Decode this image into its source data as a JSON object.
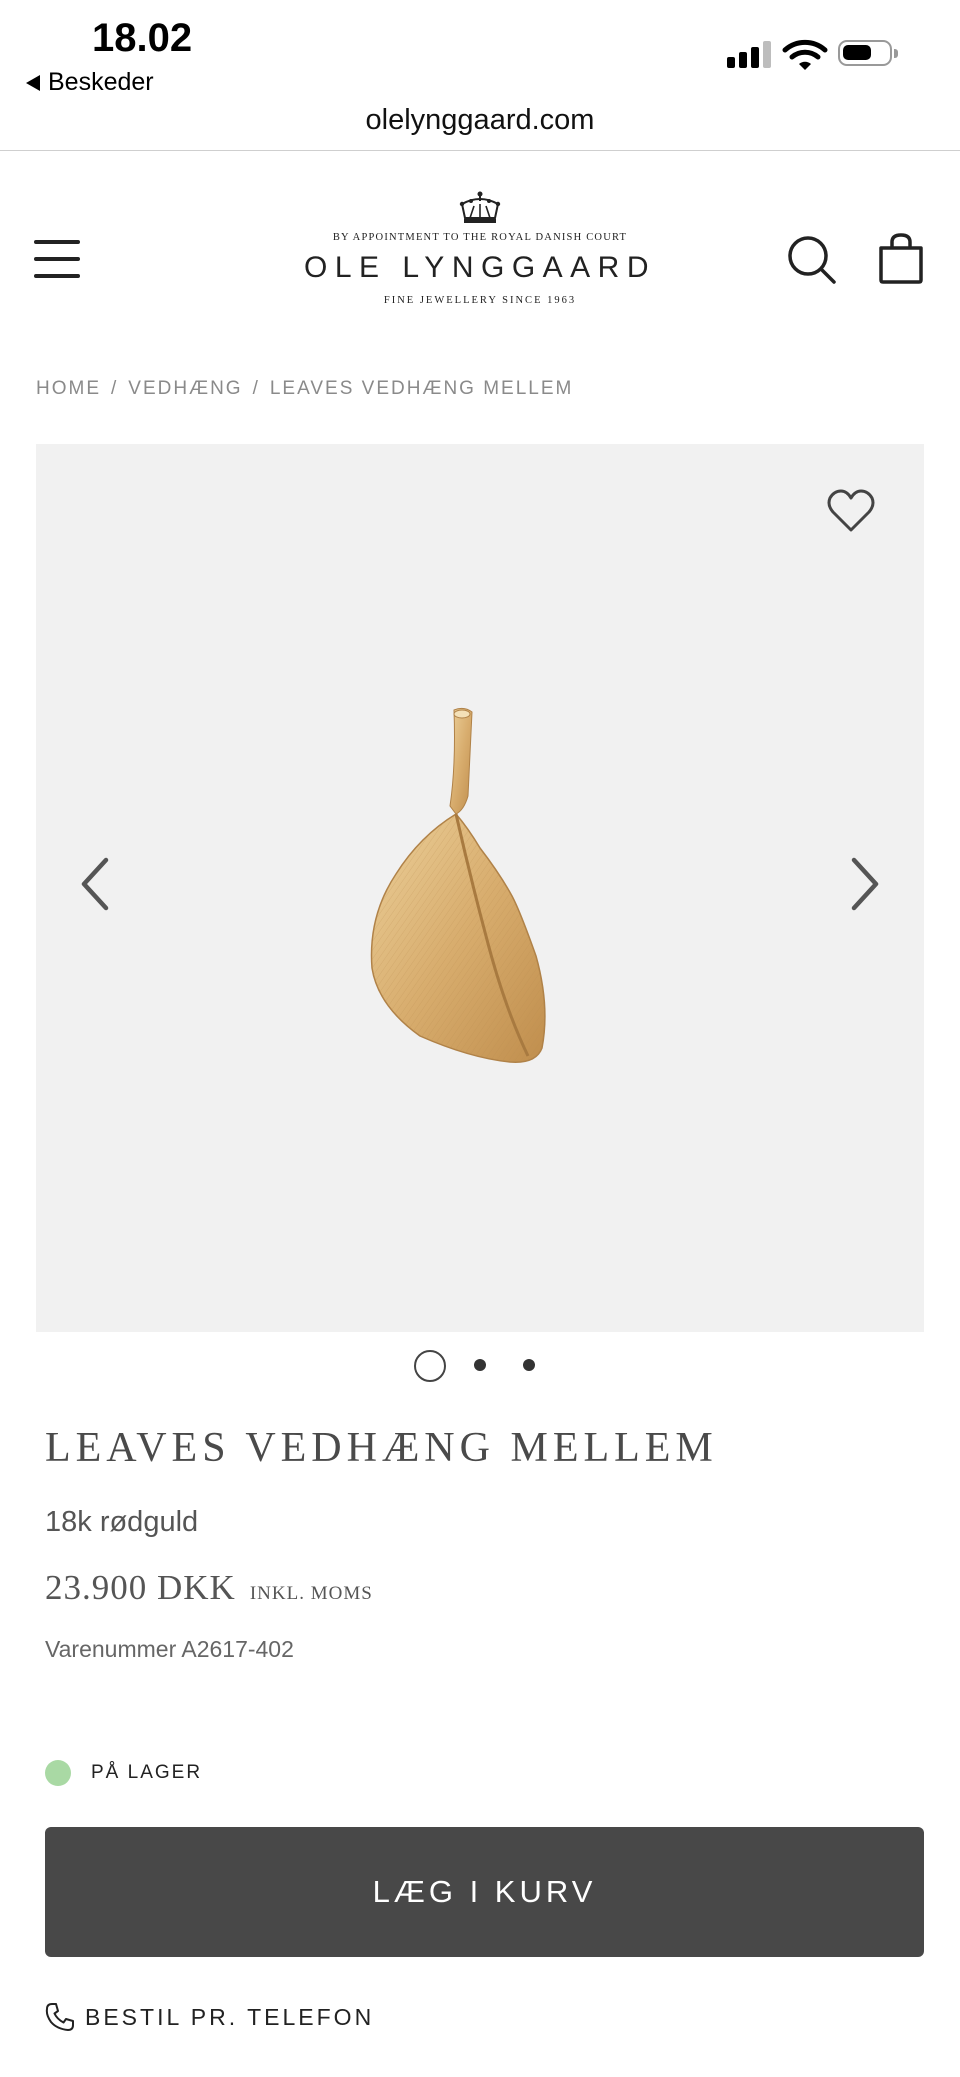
{
  "status_bar": {
    "time": "18.02",
    "back_app": "Beskeder",
    "signal_icon": "cellular-signal-icon",
    "wifi_icon": "wifi-icon",
    "battery_icon": "battery-icon",
    "signal_bars_filled": 3,
    "signal_bars_total": 4
  },
  "browser": {
    "url": "olelynggaard.com"
  },
  "header": {
    "logo": {
      "tagline": "BY APPOINTMENT TO THE ROYAL DANISH COURT",
      "brand": "OLE LYNGGAARD",
      "since": "FINE JEWELLERY SINCE 1963"
    },
    "menu_icon": "hamburger-menu-icon",
    "search_icon": "search-icon",
    "bag_icon": "shopping-bag-icon"
  },
  "breadcrumb": [
    "HOME",
    "VEDHÆNG",
    "LEAVES VEDHÆNG MELLEM"
  ],
  "gallery": {
    "image": "gold leaf pendant",
    "slide_count": 3,
    "active_slide": 1,
    "wishlist_icon": "heart-icon",
    "prev_icon": "chevron-left-icon",
    "next_icon": "chevron-right-icon"
  },
  "product": {
    "title": "LEAVES VEDHÆNG MELLEM",
    "material": "18k rødguld",
    "price": "23.900 DKK",
    "vat_note": "INKL. MOMS",
    "sku": "Varenummer A2617-402",
    "stock": {
      "label": "PÅ LAGER",
      "color": "#a9d9a4"
    }
  },
  "actions": {
    "add_to_cart": "LÆG I KURV",
    "order_by_phone": "BESTIL PR. TELEFON",
    "phone_icon": "phone-icon",
    "button_color": "#484848"
  }
}
